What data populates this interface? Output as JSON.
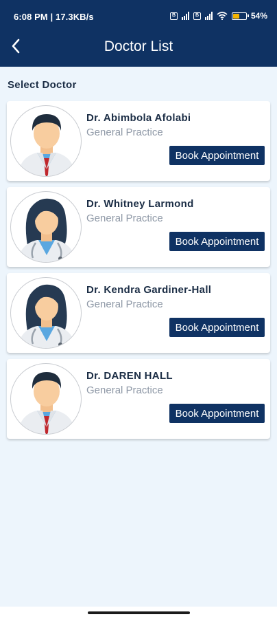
{
  "status_bar": {
    "time": "6:08 PM | 17.3KB/s",
    "battery_percent": "54",
    "battery_level": 0.54
  },
  "header": {
    "title": "Doctor List",
    "back_icon": "chevron-left-icon"
  },
  "section_title": "Select Doctor",
  "doctors": [
    {
      "name": "Dr. Abimbola Afolabi",
      "specialty": "General Practice",
      "button": "Book Appointment",
      "avatar": "male-doctor-icon"
    },
    {
      "name": "Dr. Whitney Larmond",
      "specialty": "General Practice",
      "button": "Book Appointment",
      "avatar": "female-doctor-icon"
    },
    {
      "name": "Dr. Kendra Gardiner-Hall",
      "specialty": "General Practice",
      "button": "Book Appointment",
      "avatar": "female-doctor-icon"
    },
    {
      "name": "Dr. DAREN HALL",
      "specialty": "General Practice",
      "button": "Book Appointment",
      "avatar": "male-doctor-icon"
    }
  ],
  "colors": {
    "primary": "#0f3263",
    "background": "#edf5fc",
    "subtitle": "#8e98a6"
  }
}
